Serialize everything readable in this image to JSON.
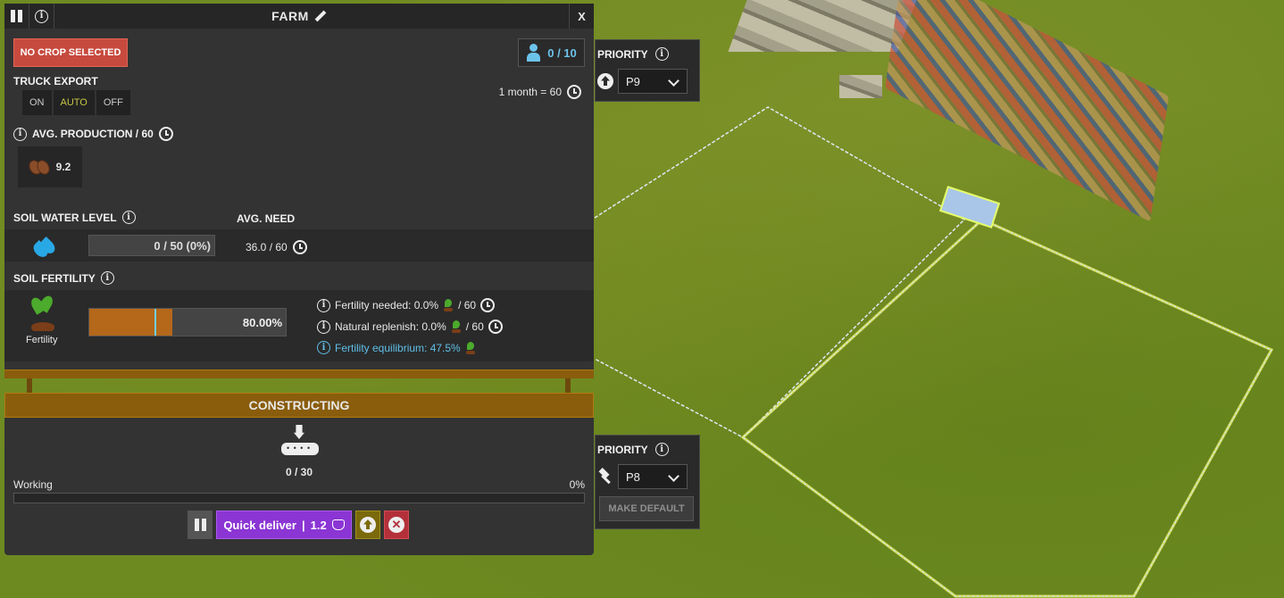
{
  "farm": {
    "title": "FARM",
    "no_crop_label": "NO CROP SELECTED",
    "workers": "0 / 10",
    "truck_export_label": "TRUCK EXPORT",
    "truck_options": [
      "ON",
      "AUTO",
      "OFF"
    ],
    "truck_selected": "AUTO",
    "month_note": "1 month = 60",
    "avg_production_label": "AVG. PRODUCTION / 60",
    "production_value": "9.2",
    "soil_water_label": "SOIL WATER LEVEL",
    "avg_need_label": "AVG. NEED",
    "water_value": "0 / 50 (0%)",
    "water_fraction": 0,
    "avg_need_value": "36.0 / 60",
    "soil_fertility_label": "SOIL FERTILITY",
    "fertility_caption": "Fertility",
    "fertility_value": "80.00%",
    "fertility_fraction": 0.8,
    "fertility_equilibrium_fraction": 0.475,
    "fertility_needed": "Fertility needed: 0.0%",
    "fertility_needed_suffix": "/ 60",
    "natural_replenish": "Natural replenish: 0.0%",
    "natural_replenish_suffix": "/ 60",
    "fertility_equilibrium": "Fertility equilibrium: 47.5%"
  },
  "construct": {
    "header": "CONSTRUCTING",
    "count": "0 / 30",
    "working_label": "Working",
    "working_pct": "0%",
    "quick_deliver_label": "Quick deliver",
    "quick_deliver_cost": "1.2"
  },
  "priority_top": {
    "label": "PRIORITY",
    "value": "P9"
  },
  "priority_bottom": {
    "label": "PRIORITY",
    "value": "P8",
    "make_default_label": "MAKE DEFAULT"
  },
  "colors": {
    "accent_orange": "#8a5d0d",
    "no_crop_red": "#c74a3e",
    "quick_deliver_purple": "#8b35d4",
    "worker_blue": "#6cc3ea",
    "fertility_fill": "#b5671a"
  }
}
